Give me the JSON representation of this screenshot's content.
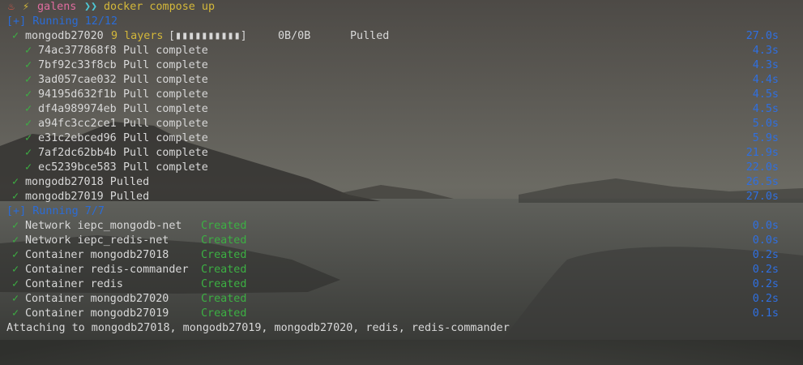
{
  "prompt": {
    "icon_a": "♨",
    "icon_b": "⚡",
    "user": "galens",
    "arrows": "❯❯",
    "command": "docker compose up"
  },
  "colors": {
    "blue": "#2b6cd6",
    "green": "#3cb043",
    "yellow": "#d4b83a",
    "pink": "#e06c9f"
  },
  "section1": {
    "header": "[+] Running 12/12",
    "main": {
      "name": "mongodb27020",
      "layers": "9 layers",
      "bar": "[▮▮▮▮▮▮▮▮▮▮]",
      "size": "0B/0B",
      "status": "Pulled",
      "time": "27.0s"
    },
    "layers": [
      {
        "id": "74ac377868f8",
        "status": "Pull complete",
        "time": "4.3s"
      },
      {
        "id": "7bf92c33f8cb",
        "status": "Pull complete",
        "time": "4.3s"
      },
      {
        "id": "3ad057cae032",
        "status": "Pull complete",
        "time": "4.4s"
      },
      {
        "id": "94195d632f1b",
        "status": "Pull complete",
        "time": "4.5s"
      },
      {
        "id": "df4a989974eb",
        "status": "Pull complete",
        "time": "4.5s"
      },
      {
        "id": "a94fc3cc2ce1",
        "status": "Pull complete",
        "time": "5.0s"
      },
      {
        "id": "e31c2ebced96",
        "status": "Pull complete",
        "time": "5.9s"
      },
      {
        "id": "7af2dc62bb4b",
        "status": "Pull complete",
        "time": "21.9s"
      },
      {
        "id": "ec5239bce583",
        "status": "Pull complete",
        "time": "22.0s"
      }
    ],
    "pulled": [
      {
        "name": "mongodb27018 Pulled",
        "time": "26.5s"
      },
      {
        "name": "mongodb27019 Pulled",
        "time": "27.0s"
      }
    ]
  },
  "section2": {
    "header": "[+] Running 7/7",
    "items": [
      {
        "label": "Network iepc_mongodb-net",
        "status": "Created",
        "time": "0.0s"
      },
      {
        "label": "Network iepc_redis-net",
        "status": "Created",
        "time": "0.0s"
      },
      {
        "label": "Container mongodb27018",
        "status": "Created",
        "time": "0.2s"
      },
      {
        "label": "Container redis-commander",
        "status": "Created",
        "time": "0.2s"
      },
      {
        "label": "Container redis",
        "status": "Created",
        "time": "0.2s"
      },
      {
        "label": "Container mongodb27020",
        "status": "Created",
        "time": "0.2s"
      },
      {
        "label": "Container mongodb27019",
        "status": "Created",
        "time": "0.1s"
      }
    ]
  },
  "footer": {
    "attaching": "Attaching to mongodb27018, mongodb27019, mongodb27020, redis, redis-commander"
  },
  "check": "✓"
}
